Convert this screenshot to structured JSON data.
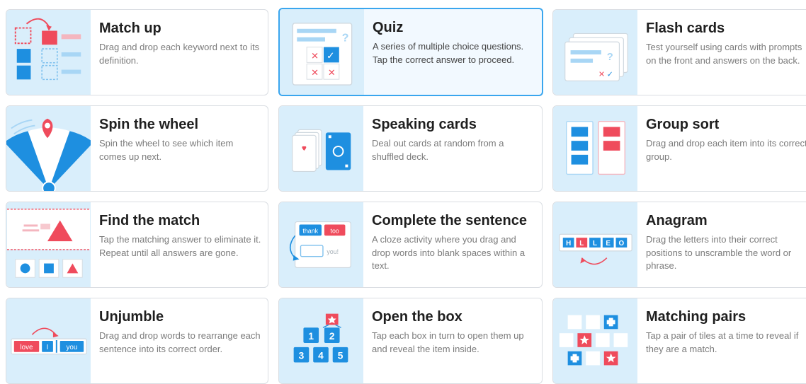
{
  "colors": {
    "accent_blue": "#1e8fe0",
    "accent_red": "#ef4b5c",
    "selected_border": "#3aa6ee",
    "thumb_bg": "#d9eefb"
  },
  "templates": [
    {
      "key": "match-up",
      "title": "Match up",
      "description": "Drag and drop each keyword next to its definition.",
      "icon": "match-up-icon"
    },
    {
      "key": "quiz",
      "title": "Quiz",
      "description": "A series of multiple choice questions. Tap the correct answer to proceed.",
      "icon": "quiz-icon",
      "selected": true
    },
    {
      "key": "flash-cards",
      "title": "Flash cards",
      "description": "Test yourself using cards with prompts on the front and answers on the back.",
      "icon": "flash-cards-icon"
    },
    {
      "key": "spin-the-wheel",
      "title": "Spin the wheel",
      "description": "Spin the wheel to see which item comes up next.",
      "icon": "spin-wheel-icon"
    },
    {
      "key": "speaking-cards",
      "title": "Speaking cards",
      "description": "Deal out cards at random from a shuffled deck.",
      "icon": "speaking-cards-icon"
    },
    {
      "key": "group-sort",
      "title": "Group sort",
      "description": "Drag and drop each item into its correct group.",
      "icon": "group-sort-icon"
    },
    {
      "key": "find-the-match",
      "title": "Find the match",
      "description": "Tap the matching answer to eliminate it. Repeat until all answers are gone.",
      "icon": "find-match-icon"
    },
    {
      "key": "complete-the-sentence",
      "title": "Complete the sentence",
      "description": "A cloze activity where you drag and drop words into blank spaces within a text.",
      "icon": "complete-sentence-icon",
      "thumb_words": [
        "thank",
        "too",
        "you!"
      ]
    },
    {
      "key": "anagram",
      "title": "Anagram",
      "description": "Drag the letters into their correct positions to unscramble the word or phrase.",
      "icon": "anagram-icon",
      "thumb_letters": [
        "H",
        "L",
        "L",
        "E",
        "O"
      ]
    },
    {
      "key": "unjumble",
      "title": "Unjumble",
      "description": "Drag and drop words to rearrange each sentence into its correct order.",
      "icon": "unjumble-icon",
      "thumb_words": [
        "love",
        "I",
        "you"
      ]
    },
    {
      "key": "open-the-box",
      "title": "Open the box",
      "description": "Tap each box in turn to open them up and reveal the item inside.",
      "icon": "open-box-icon",
      "thumb_numbers": [
        "1",
        "2",
        "3",
        "4",
        "5"
      ]
    },
    {
      "key": "matching-pairs",
      "title": "Matching pairs",
      "description": "Tap a pair of tiles at a time to reveal if they are a match.",
      "icon": "matching-pairs-icon"
    }
  ]
}
